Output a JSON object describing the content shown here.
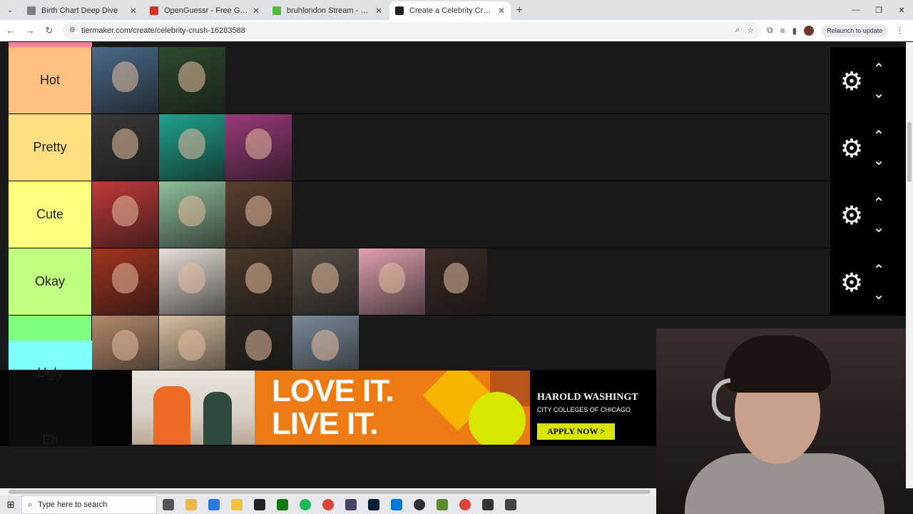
{
  "browser": {
    "tabs": [
      {
        "title": "Birth Chart Deep Dive",
        "color": "#7a7f87",
        "active": false
      },
      {
        "title": "OpenGuessr - Free GeoGuessr",
        "color": "#d93025",
        "active": false
      },
      {
        "title": "bruhlondon Stream - Watch Li",
        "color": "#53b83a",
        "active": false
      },
      {
        "title": "Create a Celebrity Crush Tier Li",
        "color": "#222222",
        "active": true
      }
    ],
    "url": "tiermaker.com/create/celebrity-crush-16283588",
    "relaunch_label": "Relaunch to update",
    "new_tab": "+",
    "tab_close": "✕",
    "win_min": "—",
    "win_max": "❐",
    "win_close": "✕"
  },
  "tiers": [
    {
      "label": "Hot",
      "color": "#ffbf7f",
      "items": [
        {
          "bg": "#4a6a8a"
        },
        {
          "bg": "#2e4a2e"
        }
      ]
    },
    {
      "label": "Pretty",
      "color": "#ffdf7f",
      "items": [
        {
          "bg": "#3a3a3a"
        },
        {
          "bg": "#1fa38f"
        },
        {
          "bg": "#9a3a7a"
        }
      ]
    },
    {
      "label": "Cute",
      "color": "#ffff7f",
      "items": [
        {
          "bg": "#c33a3a"
        },
        {
          "bg": "#8fbf9a"
        },
        {
          "bg": "#5a3f2f"
        }
      ]
    },
    {
      "label": "Okay",
      "color": "#bfff7f",
      "items": [
        {
          "bg": "#a3341f"
        },
        {
          "bg": "#e8e0d8"
        },
        {
          "bg": "#4a3a2a"
        },
        {
          "bg": "#5a5048"
        },
        {
          "bg": "#e0a0b0"
        },
        {
          "bg": "#3a2a24"
        }
      ]
    },
    {
      "label": "Ehh",
      "color": "#7fff7f",
      "items": [
        {
          "bg": "#b48a6a"
        },
        {
          "bg": "#d8c0a0"
        },
        {
          "bg": "#2a2622"
        },
        {
          "bg": "#7a8a9a"
        }
      ]
    }
  ],
  "hidden_tiers": {
    "ugly": "Ugly",
    "eh": "Eh"
  },
  "controls": {
    "gear": "⚙",
    "up": "⌃",
    "down": "⌄"
  },
  "ad": {
    "headline_1": "LOVE IT.",
    "headline_2": "LIVE IT.",
    "org": "HAROLD WASHINGT",
    "sub": "CITY COLLEGES OF CHICAGO",
    "cta": "APPLY NOW >"
  },
  "taskbar": {
    "search_placeholder": "Type here to search",
    "apps": [
      {
        "name": "task-view",
        "color": "#555555"
      },
      {
        "name": "file-explorer",
        "color": "#e8b84a"
      },
      {
        "name": "vscode-blue",
        "color": "#2b7bd6"
      },
      {
        "name": "folder",
        "color": "#f0c040"
      },
      {
        "name": "terminal",
        "color": "#222222"
      },
      {
        "name": "xbox",
        "color": "#107c10"
      },
      {
        "name": "spotify",
        "color": "#1db954"
      },
      {
        "name": "chrome",
        "color": "#db4437"
      },
      {
        "name": "davinci",
        "color": "#444466"
      },
      {
        "name": "photoshop",
        "color": "#001e36"
      },
      {
        "name": "vscode",
        "color": "#0078d4"
      },
      {
        "name": "obs",
        "color": "#302e31"
      },
      {
        "name": "minecraft",
        "color": "#5b8c32"
      },
      {
        "name": "chrome-active",
        "color": "#db4437"
      },
      {
        "name": "clock",
        "color": "#333333"
      },
      {
        "name": "calculator",
        "color": "#444444"
      }
    ]
  }
}
